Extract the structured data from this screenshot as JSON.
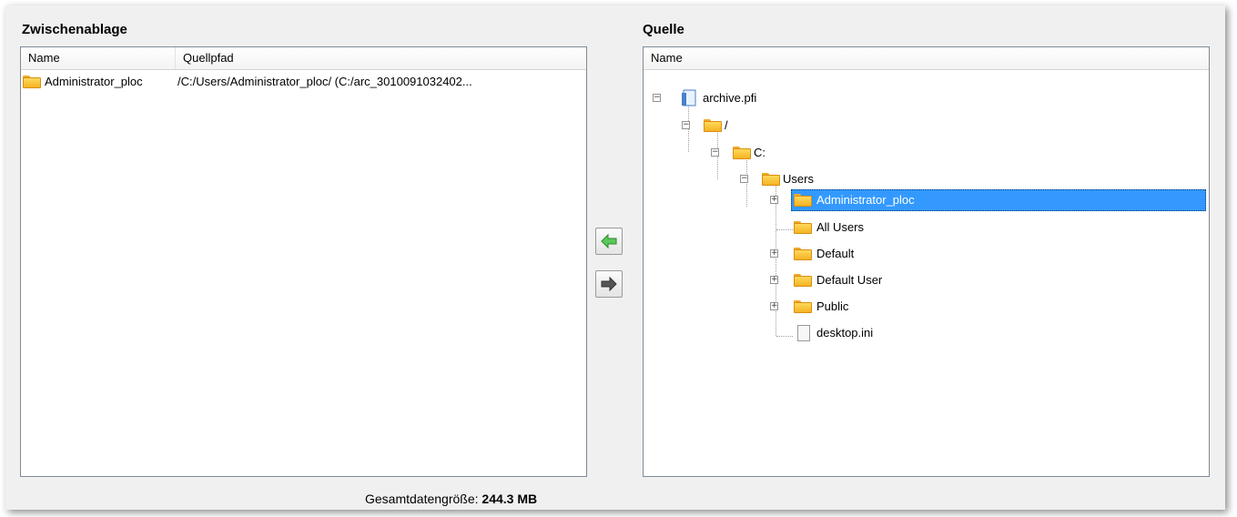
{
  "clipboard": {
    "title": "Zwischenablage",
    "columns": [
      "Name",
      "Quellpfad"
    ],
    "rows": [
      {
        "name": "Administrator_ploc",
        "source_path": "/C:/Users/Administrator_ploc/ (C:/arc_3010091032402..."
      }
    ]
  },
  "source": {
    "title": "Quelle",
    "column": "Name",
    "tree": {
      "archive": "archive.pfi",
      "root": "/",
      "drive": "C:",
      "users": "Users",
      "children": [
        "Administrator_ploc",
        "All Users",
        "Default",
        "Default User",
        "Public",
        "desktop.ini"
      ],
      "selected": "Administrator_ploc"
    }
  },
  "buttons": {
    "add_icon": "arrow-left-green-icon",
    "remove_icon": "arrow-right-gray-icon"
  },
  "footer": {
    "label": "Gesamtdatengröße:",
    "value": "244.3 MB"
  },
  "colors": {
    "selection": "#3399ff",
    "folder": "#f5b324",
    "add_arrow": "#3aa63a"
  }
}
